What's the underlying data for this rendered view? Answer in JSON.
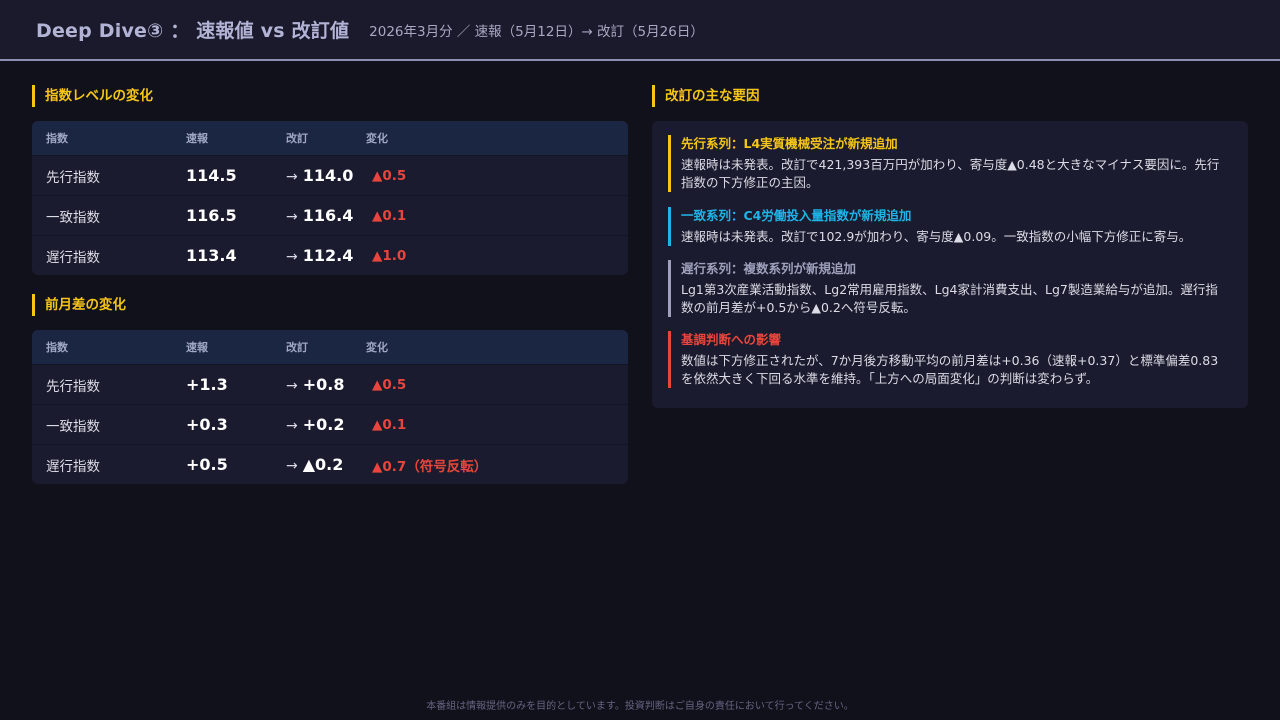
{
  "header": {
    "title": "Deep Dive③ ： 速報値 vs 改訂値",
    "subtitle": "2026年3月分 ／ 速報（5月12日）→ 改訂（5月26日）"
  },
  "levels": {
    "title": "指数レベルの変化",
    "columns": [
      "指数",
      "速報",
      "改訂",
      "変化"
    ],
    "rows": [
      {
        "name": "先行指数",
        "prelim": "114.5",
        "revised": "114.0",
        "change": "▲0.5"
      },
      {
        "name": "一致指数",
        "prelim": "116.5",
        "revised": "116.4",
        "change": "▲0.1"
      },
      {
        "name": "遅行指数",
        "prelim": "113.4",
        "revised": "112.4",
        "change": "▲1.0"
      }
    ]
  },
  "diffs": {
    "title": "前月差の変化",
    "columns": [
      "指数",
      "速報",
      "改訂",
      "変化"
    ],
    "rows": [
      {
        "name": "先行指数",
        "prelim": "+1.3",
        "revised": "+0.8",
        "change": "▲0.5"
      },
      {
        "name": "一致指数",
        "prelim": "+0.3",
        "revised": "+0.2",
        "change": "▲0.1"
      },
      {
        "name": "遅行指数",
        "prelim": "+0.5",
        "revised": "▲0.2",
        "change": "▲0.7（符号反転）"
      }
    ]
  },
  "arrow": "→",
  "factors": {
    "title": "改訂の主な要因",
    "items": [
      {
        "title": "先行系列：L4実質機械受注が新規追加",
        "text": "速報時は未発表。改訂で421,393百万円が加わり、寄与度▲0.48と大きなマイナス要因に。先行指数の下方修正の主因。",
        "color": "#f5c518"
      },
      {
        "title": "一致系列：C4労働投入量指数が新規追加",
        "text": "速報時は未発表。改訂で102.9が加わり、寄与度▲0.09。一致指数の小幅下方修正に寄与。",
        "color": "#1fb4e8"
      },
      {
        "title": "遅行系列：複数系列が新規追加",
        "text": "Lg1第3次産業活動指数、Lg2常用雇用指数、Lg4家計消費支出、Lg7製造業給与が追加。遅行指数の前月差が+0.5から▲0.2へ符号反転。",
        "color": "#9ea0bc"
      },
      {
        "title": "基調判断への影響",
        "text": "数値は下方修正されたが、7か月後方移動平均の前月差は+0.36（速報+0.37）と標準偏差0.83を依然大きく下回る水準を維持。「上方への局面変化」の判断は変わらず。",
        "color": "#e8453c"
      }
    ]
  },
  "footer": "本番組は情報提供のみを目的としています。投資判断はご自身の責任において行ってください。"
}
